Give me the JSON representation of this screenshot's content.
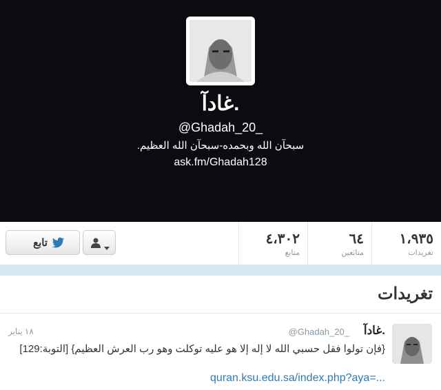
{
  "profile": {
    "name": "غادآ.",
    "handle": "@Ghadah_20_",
    "bio": "سبحآن الله وبحمده-سبحآن الله العظيم.",
    "link": "ask.fm/Ghadah128"
  },
  "stats": {
    "tweets": {
      "value": "١،٩٣٥",
      "label": "تغريدات"
    },
    "following": {
      "value": "٦٤",
      "label": "متابَعين"
    },
    "followers": {
      "value": "٤،٣٠٢",
      "label": "متابع"
    }
  },
  "actions": {
    "follow_label": "تابع",
    "user_menu_icon": "user-icon"
  },
  "section": {
    "title": "تغريدات"
  },
  "tweet": {
    "name": "غادآ.",
    "handle": "@Ghadah_20_",
    "time": "١٨ يناير",
    "text": "{فإن تولوا فقل حسبي الله لا إله إلا هو عليه توكلت وهو رب العرش العظيم} [التوبة:129]",
    "link": "quran.ksu.edu.sa/index.php?aya=..."
  },
  "colors": {
    "header_bg": "#0c0b10",
    "accent": "#2b7bb9",
    "band": "#d6e9f4"
  }
}
